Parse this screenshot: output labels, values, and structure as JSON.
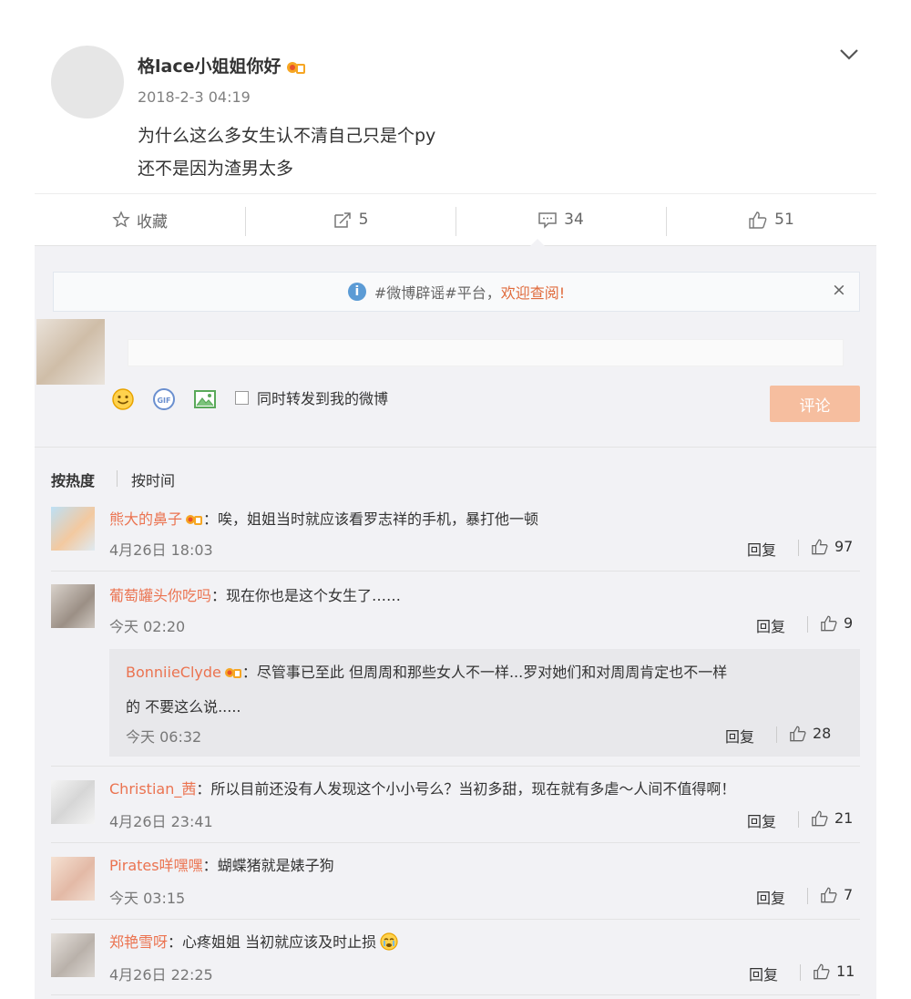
{
  "post": {
    "username": "格lace小姐姐你好",
    "time": "2018-2-3 04:19",
    "lines": [
      "为什么这么多女生认不清自己只是个py",
      "还不是因为渣男太多"
    ]
  },
  "actions": [
    {
      "label": "收藏",
      "icon": "star-icon"
    },
    {
      "label": "5",
      "icon": "repost-icon"
    },
    {
      "label": "34",
      "icon": "comment-icon"
    },
    {
      "label": "51",
      "icon": "thumbs-up-icon"
    }
  ],
  "notice": {
    "tag": "#微博辟谣#平台，",
    "link": "欢迎查阅!",
    "close": "×"
  },
  "composer": {
    "repost_label": "同时转发到我的微博",
    "submit": "评论"
  },
  "sort": {
    "hot": "按热度",
    "time": "按时间"
  },
  "comments": [
    {
      "name": "熊大的鼻子",
      "text": "：唉，姐姐当时就应该看罗志祥的手机，暴打他一顿",
      "time": "4月26日 18:03",
      "reply": "回复",
      "likes": "97"
    },
    {
      "name": "葡萄罐头你吃吗",
      "text": "：现在你也是这个女生了……",
      "time": "今天 02:20",
      "reply": "回复",
      "likes": "9"
    },
    {
      "name": "Christian_茜",
      "text": "：所以目前还没有人发现这个小小号么？当初多甜，现在就有多虐～人间不值得啊！",
      "time": "4月26日 23:41",
      "reply": "回复",
      "likes": "21"
    },
    {
      "name": "Pirates咩嘿嘿",
      "text": "：蝴蝶猪就是婊子狗",
      "time": "今天 03:15",
      "reply": "回复",
      "likes": "7"
    },
    {
      "name": "郑艳雪呀",
      "text": "：心疼姐姐 当初就应该及时止损",
      "time": "4月26日 22:25",
      "reply": "回复",
      "likes": "11"
    }
  ],
  "sub_reply": {
    "name": "BonniieClyde",
    "line1": "：尽管事已至此 但周周和那些女人不一样...罗对她们和对周周肯定也不一样",
    "line2": "的 不要这么说.....",
    "time": "今天 06:32",
    "reply": "回复",
    "likes": "28"
  }
}
